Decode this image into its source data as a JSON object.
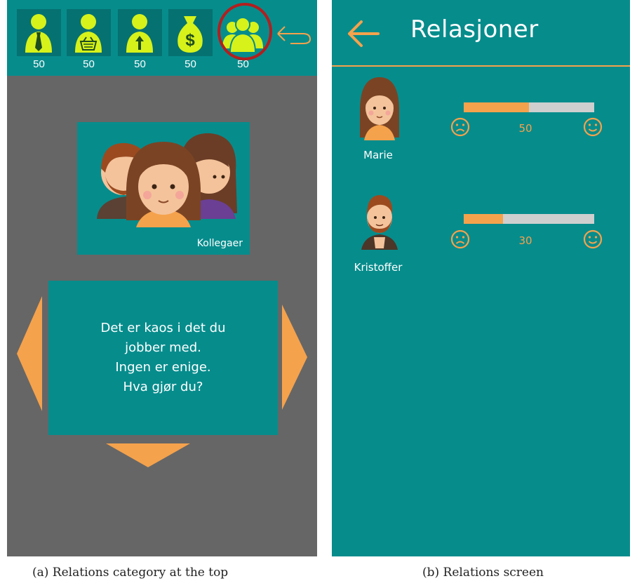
{
  "left_screen": {
    "stats": [
      {
        "icon": "businessperson-tie-icon",
        "value": "50"
      },
      {
        "icon": "shopper-basket-icon",
        "value": "50"
      },
      {
        "icon": "person-arrow-up-icon",
        "value": "50"
      },
      {
        "icon": "money-bag-icon",
        "value": "50"
      },
      {
        "icon": "group-people-icon",
        "value": "50"
      }
    ],
    "card_label": "Kollegaer",
    "question": "Det er kaos i det du\njobber med.\nIngen er enige.\nHva gjør du?",
    "colors": {
      "teal": "#078c8c",
      "tile": "#067171",
      "icon_green": "#d6f21a",
      "orange": "#f5a24c",
      "gray": "#666666",
      "highlight": "#b41e1e"
    }
  },
  "right_screen": {
    "title": "Relasjoner",
    "people": [
      {
        "name": "Marie",
        "score": "50",
        "relation": 0.5
      },
      {
        "name": "Kristoffer",
        "score": "30",
        "relation": 0.3
      }
    ]
  },
  "captions": {
    "a": "(a) Relations category at the top",
    "b": "(b) Relations screen"
  }
}
